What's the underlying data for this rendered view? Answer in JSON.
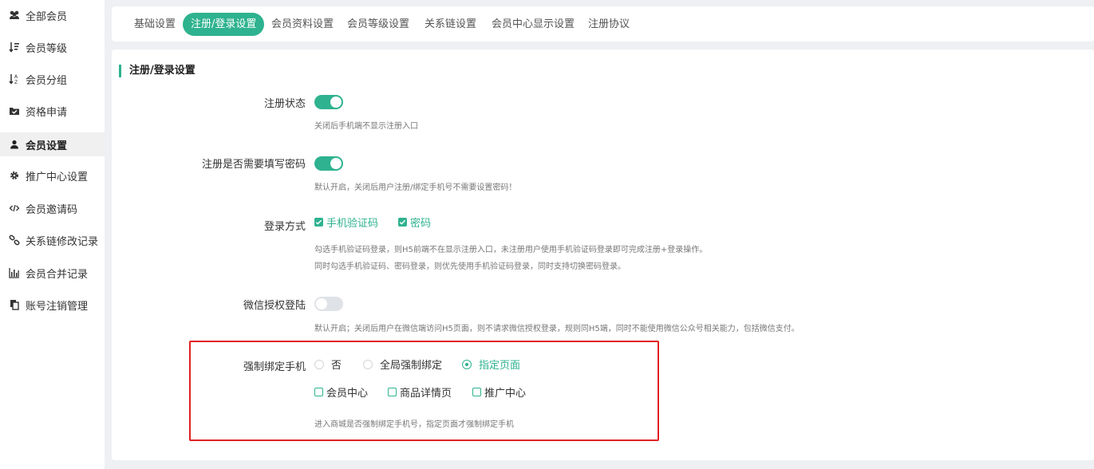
{
  "sidebar": {
    "items": [
      {
        "label": "全部会员",
        "icon": "users-icon"
      },
      {
        "label": "会员等级",
        "icon": "sort-level-icon"
      },
      {
        "label": "会员分组",
        "icon": "sort-alpha-icon"
      },
      {
        "label": "资格申请",
        "icon": "folder-check-icon"
      },
      {
        "label": "会员设置",
        "icon": "user-icon"
      },
      {
        "label": "推广中心设置",
        "icon": "gear-icon"
      },
      {
        "label": "会员邀请码",
        "icon": "code-icon"
      },
      {
        "label": "关系链修改记录",
        "icon": "link-icon"
      },
      {
        "label": "会员合并记录",
        "icon": "bar-chart-icon"
      },
      {
        "label": "账号注销管理",
        "icon": "copy-icon"
      }
    ],
    "active_index": 4
  },
  "tabs": [
    {
      "label": "基础设置"
    },
    {
      "label": "注册/登录设置"
    },
    {
      "label": "会员资料设置"
    },
    {
      "label": "会员等级设置"
    },
    {
      "label": "关系链设置"
    },
    {
      "label": "会员中心显示设置"
    },
    {
      "label": "注册协议"
    }
  ],
  "active_tab": 1,
  "section": {
    "title": "注册/登录设置"
  },
  "form": {
    "register_status": {
      "label": "注册状态",
      "enabled": true,
      "help": "关闭后手机端不显示注册入口"
    },
    "register_password": {
      "label": "注册是否需要填写密码",
      "enabled": true,
      "help": "默认开启，关闭后用户注册/绑定手机号不需要设置密码！"
    },
    "login_method": {
      "label": "登录方式",
      "options": [
        {
          "label": "手机验证码",
          "checked": true
        },
        {
          "label": "密码",
          "checked": true
        }
      ],
      "help_1": "勾选手机验证码登录，则H5前端不在显示注册入口，未注册用户使用手机验证码登录即可完成注册+登录操作。",
      "help_2": "同时勾选手机验证码、密码登录，则优先使用手机验证码登录，同时支持切换密码登录。"
    },
    "wechat_login": {
      "label": "微信授权登陆",
      "enabled": false,
      "help": "默认开启；关闭后用户在微信端访问H5页面，则不请求微信授权登录，规则同H5端，同时不能使用微信公众号相关能力，包括微信支付。"
    },
    "force_bind_phone": {
      "label": "强制绑定手机",
      "radios": [
        {
          "label": "否",
          "selected": false
        },
        {
          "label": "全局强制绑定",
          "selected": false
        },
        {
          "label": "指定页面",
          "selected": true
        }
      ],
      "pages": [
        {
          "label": "会员中心",
          "checked": false
        },
        {
          "label": "商品详情页",
          "checked": false
        },
        {
          "label": "推广中心",
          "checked": false
        }
      ],
      "help": "进入商城是否强制绑定手机号，指定页面才强制绑定手机"
    }
  },
  "colors": {
    "accent": "#2eb28f",
    "highlight": "#e02020"
  }
}
